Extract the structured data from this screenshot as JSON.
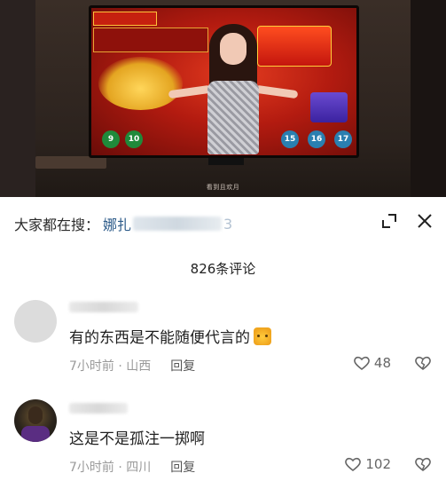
{
  "search": {
    "prefix": "大家都在搜：",
    "term": "娜扎",
    "tail": "3"
  },
  "comments_count": "826条评论",
  "comments": [
    {
      "text": "有的东西是不能随便代言的",
      "time_location": "7小时前 · 山西",
      "reply_label": "回复",
      "likes": "48",
      "avatar": "gray-avatar"
    },
    {
      "text": "这是不是孤注一掷啊",
      "time_location": "7小时前 · 四川",
      "reply_label": "回复",
      "likes": "102",
      "avatar": "basketball-player-avatar"
    }
  ],
  "video": {
    "subtitle": "看到且欢月",
    "ball_numbers": [
      "9",
      "10",
      "15",
      "16",
      "17"
    ],
    "colors": {
      "screen_red": "#b31b10",
      "gold": "#ffd65a"
    }
  },
  "icons": [
    "collapse-icon",
    "close-icon",
    "heart-icon",
    "dislike-heart-icon",
    "emoji-icon"
  ],
  "colors": {
    "link_blue": "#2e5c8a",
    "meta_gray": "#9a9a9a",
    "text": "#1f1f1f"
  }
}
